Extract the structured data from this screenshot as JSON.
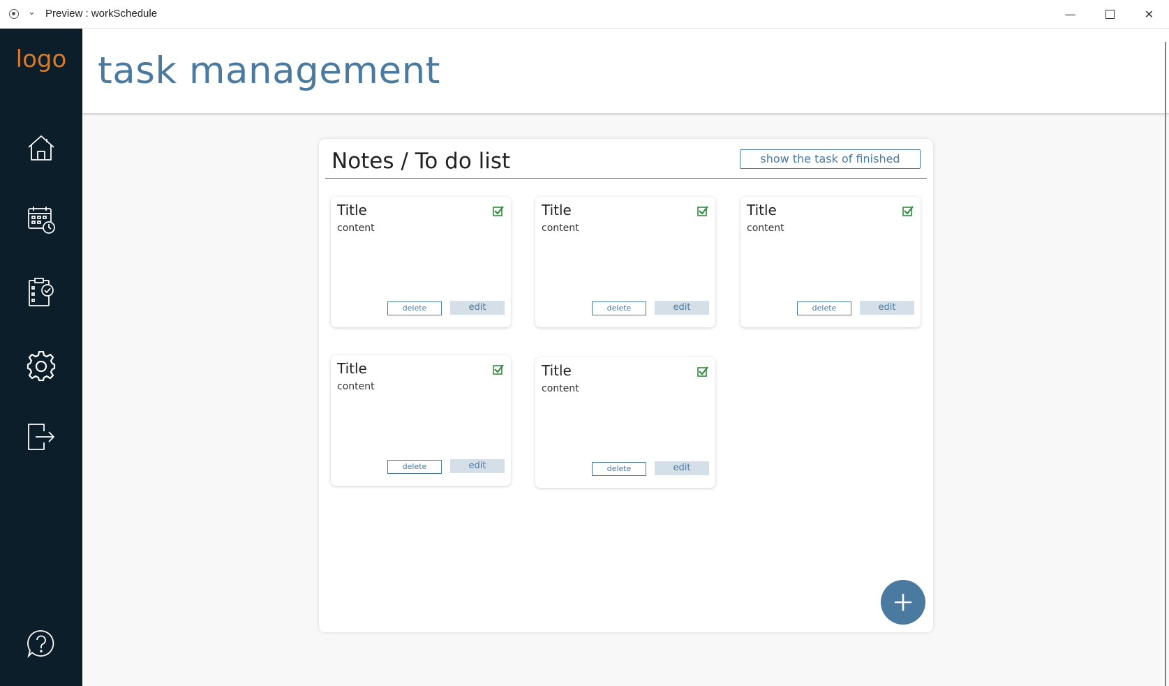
{
  "window": {
    "title": "Preview : workSchedule",
    "minimize_glyph": "—",
    "close_glyph": "✕"
  },
  "sidebar": {
    "logo": "logo",
    "icons": [
      "home-icon",
      "calendar-clock-icon",
      "task-checklist-icon",
      "settings-gear-icon",
      "logout-icon",
      "help-icon"
    ]
  },
  "header": {
    "title": "task management"
  },
  "panel": {
    "title": "Notes / To do list",
    "finished_button": "show the task of finished"
  },
  "cards": [
    {
      "title": "Title",
      "content": "content",
      "checked": true,
      "delete_label": "delete",
      "edit_label": "edit"
    },
    {
      "title": "Title",
      "content": "content",
      "checked": true,
      "delete_label": "delete",
      "edit_label": "edit"
    },
    {
      "title": "Title",
      "content": "content",
      "checked": true,
      "delete_label": "delete",
      "edit_label": "edit"
    },
    {
      "title": "Title",
      "content": "content",
      "checked": true,
      "delete_label": "delete",
      "edit_label": "edit"
    },
    {
      "title": "Title",
      "content": "content",
      "checked": true,
      "delete_label": "delete",
      "edit_label": "edit"
    }
  ],
  "colors": {
    "sidebar_bg": "#0c1e2a",
    "accent": "#4a7aa0",
    "logo": "#d77a2b",
    "check": "#2e8b3a",
    "edit_button_bg": "#d4dfe8"
  }
}
